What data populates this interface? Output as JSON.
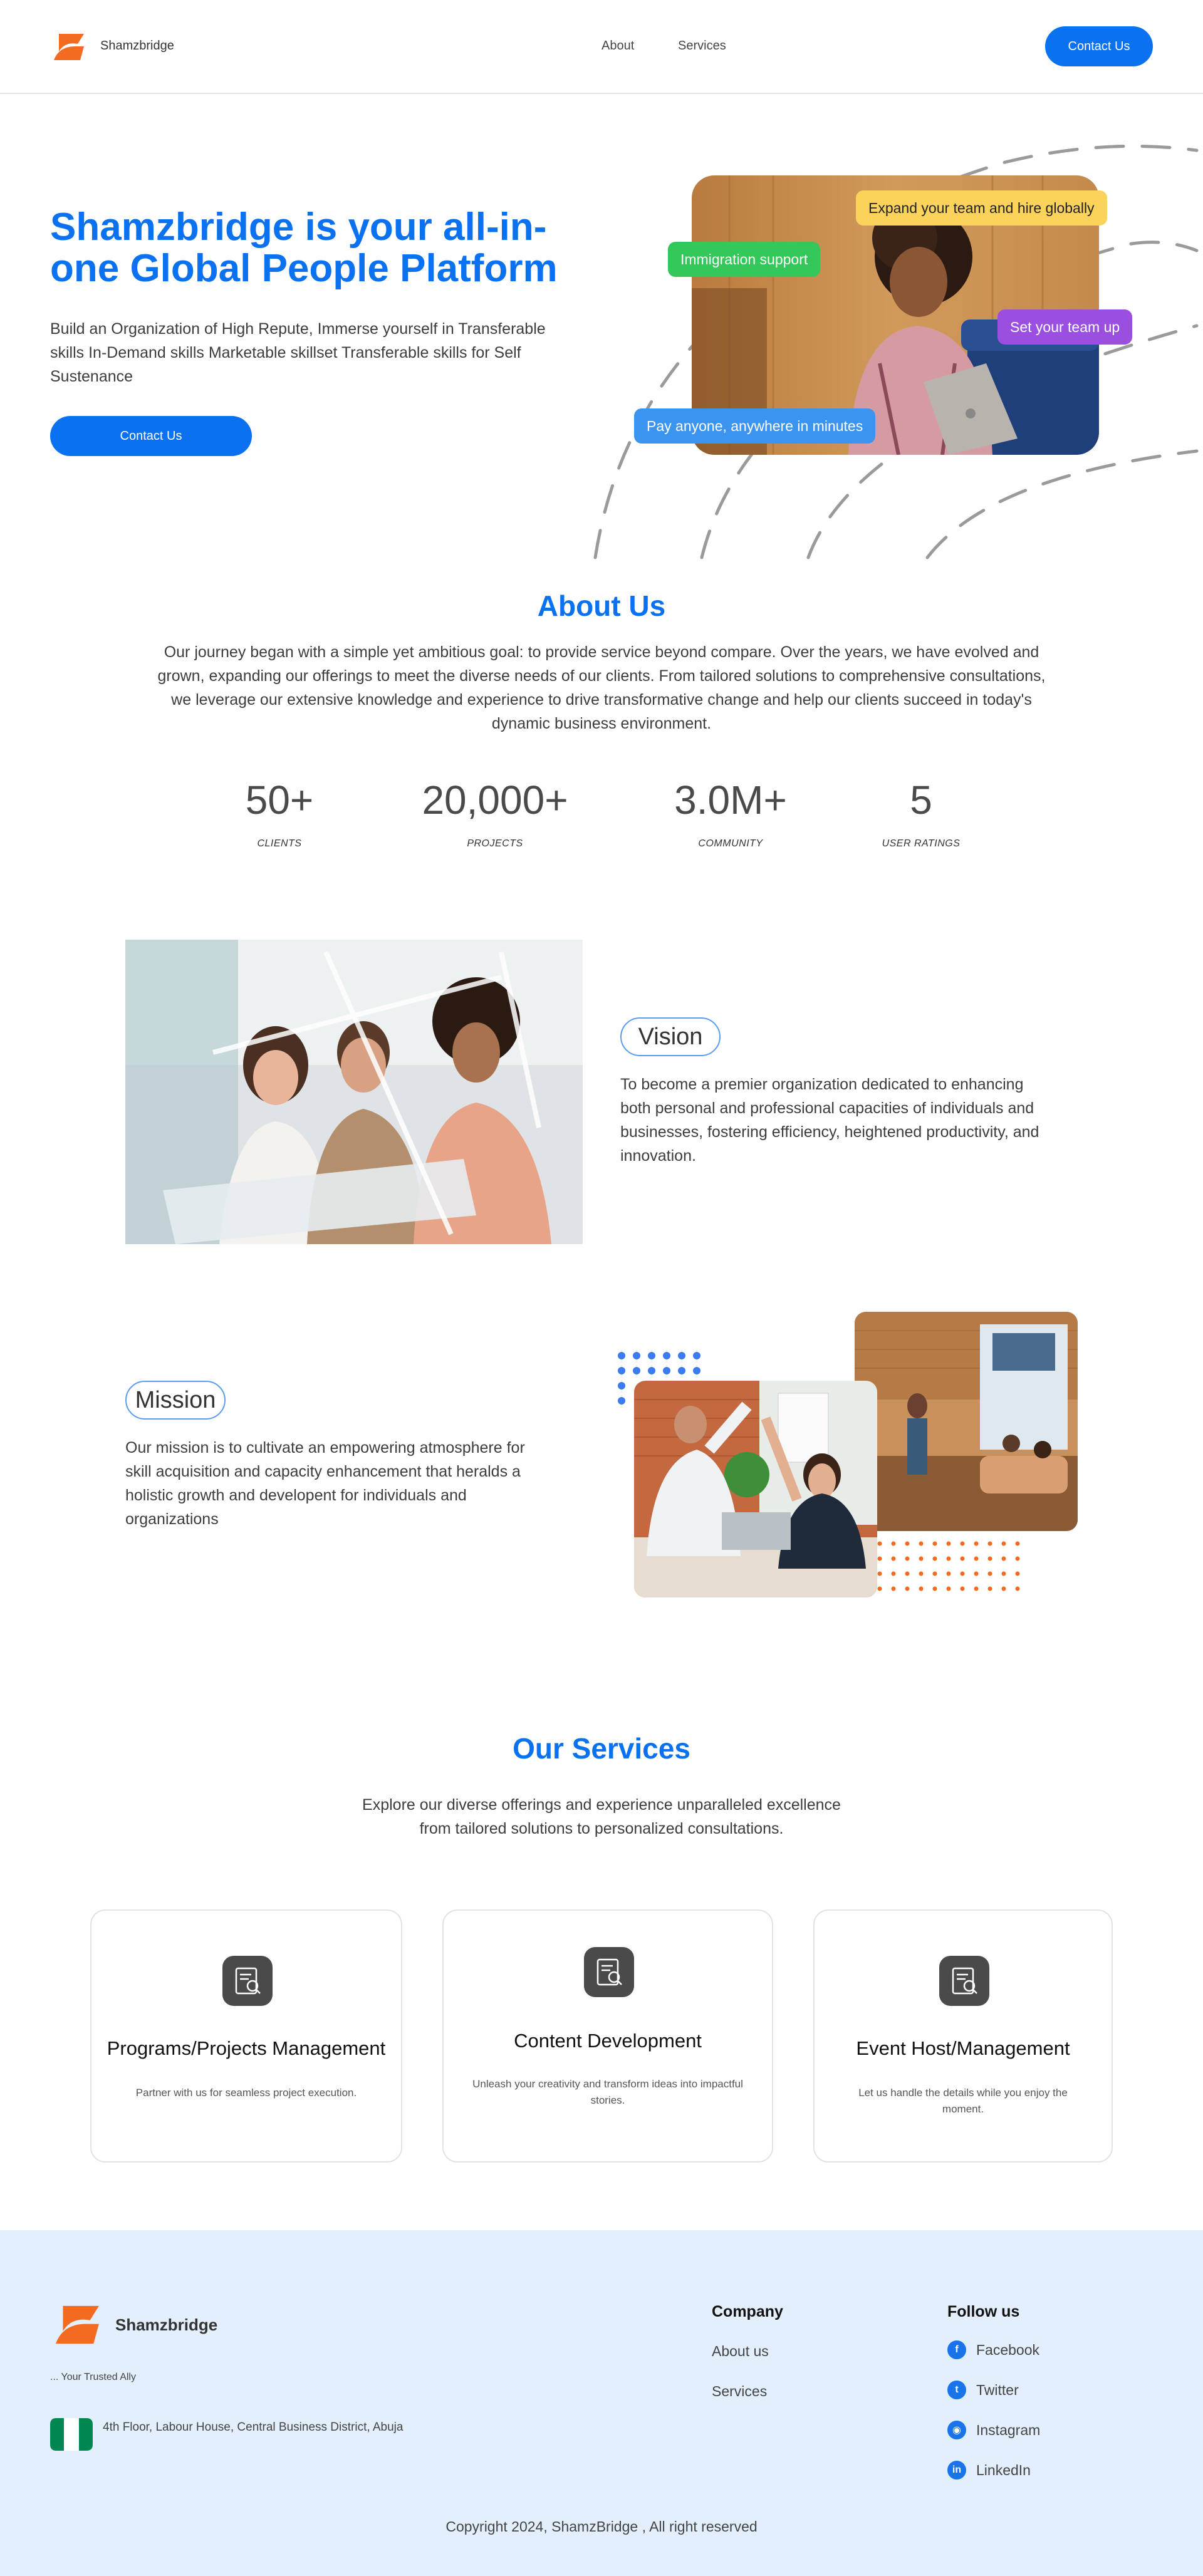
{
  "nav": {
    "brand": "Shamzbridge",
    "links": [
      "About",
      "Services"
    ],
    "cta": "Contact Us"
  },
  "hero": {
    "title": "Shamzbridge is your all-in-one Global People Platform",
    "subtitle": "Build an Organization of High Repute, Immerse yourself in Transferable skills In-Demand skills Marketable skillset Transferable skills for Self Sustenance",
    "cta": "Contact Us",
    "bubbles": [
      {
        "text": "Expand your team and hire globally",
        "color": "#fbd25a"
      },
      {
        "text": "Immigration support",
        "color": "#34c759"
      },
      {
        "text": "Set your team up",
        "color": "#9b4fe0"
      },
      {
        "text": "Pay anyone, anywhere in minutes",
        "color": "#3b95f0"
      }
    ]
  },
  "about": {
    "title": "About Us",
    "text": "Our journey began with a simple yet ambitious goal: to provide service beyond compare. Over the years, we have evolved and grown, expanding our offerings to meet the diverse needs of our clients. From tailored solutions to comprehensive consultations, we leverage our extensive knowledge and experience to drive transformative change and help our clients succeed in today's dynamic business environment.",
    "stats": [
      {
        "value": "50+",
        "label": "CLIENTS"
      },
      {
        "value": "20,000+",
        "label": "PROJECTS"
      },
      {
        "value": "3.0M+",
        "label": "COMMUNITY"
      },
      {
        "value": "5",
        "label": "USER RATINGS"
      }
    ]
  },
  "vision": {
    "label": "Vision",
    "text": "To become a premier organization dedicated to enhancing both personal and professional capacities of individuals and businesses, fostering efficiency, heightened productivity, and innovation."
  },
  "mission": {
    "label": "Mission",
    "text": "Our mission is to cultivate an empowering atmosphere for skill acquisition and capacity enhancement that heralds a holistic growth and developent for individuals and organizations"
  },
  "services": {
    "title": "Our Services",
    "intro": "Explore our diverse offerings and experience unparalleled excellence from tailored solutions to personalized consultations.",
    "cards": [
      {
        "title": "Programs/Projects Management",
        "desc": "Partner with us for seamless project execution.",
        "icon": "document-search-icon"
      },
      {
        "title": "Content Development",
        "desc": "Unleash your creativity and transform ideas into impactful stories.",
        "icon": "document-search-icon"
      },
      {
        "title": "Event Host/Management",
        "desc": "Let us handle the details while you enjoy the moment.",
        "icon": "document-search-icon"
      }
    ]
  },
  "footer": {
    "brand": "Shamzbridge",
    "tagline": "... Your Trusted Ally",
    "address": "4th Floor, Labour House, Central Business District, Abuja",
    "company_heading": "Company",
    "company_links": [
      "About us",
      "Services"
    ],
    "follow_heading": "Follow us",
    "social": [
      {
        "label": "Facebook",
        "icon": "facebook-icon"
      },
      {
        "label": "Twitter",
        "icon": "twitter-icon"
      },
      {
        "label": "Instagram",
        "icon": "instagram-icon"
      },
      {
        "label": "LinkedIn",
        "icon": "linkedin-icon"
      }
    ],
    "copyright": "Copyright 2024, ShamzBridge , All right reserved"
  },
  "colors": {
    "primary": "#0a72f0",
    "accent": "#f26b21",
    "footer_bg": "#e3effc"
  }
}
